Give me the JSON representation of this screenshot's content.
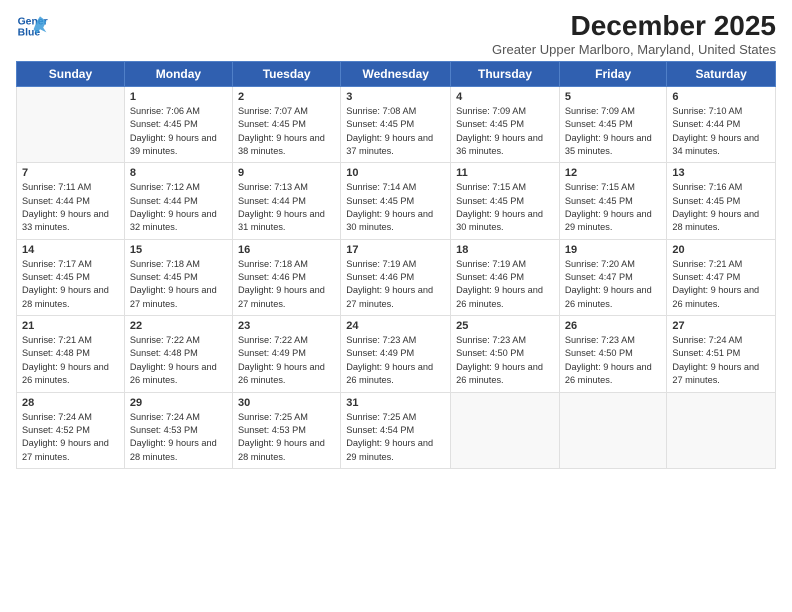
{
  "logo": {
    "line1": "General",
    "line2": "Blue"
  },
  "title": "December 2025",
  "subtitle": "Greater Upper Marlboro, Maryland, United States",
  "weekdays": [
    "Sunday",
    "Monday",
    "Tuesday",
    "Wednesday",
    "Thursday",
    "Friday",
    "Saturday"
  ],
  "weeks": [
    [
      {
        "day": "",
        "sunrise": "",
        "sunset": "",
        "daylight": ""
      },
      {
        "day": "1",
        "sunrise": "Sunrise: 7:06 AM",
        "sunset": "Sunset: 4:45 PM",
        "daylight": "Daylight: 9 hours and 39 minutes."
      },
      {
        "day": "2",
        "sunrise": "Sunrise: 7:07 AM",
        "sunset": "Sunset: 4:45 PM",
        "daylight": "Daylight: 9 hours and 38 minutes."
      },
      {
        "day": "3",
        "sunrise": "Sunrise: 7:08 AM",
        "sunset": "Sunset: 4:45 PM",
        "daylight": "Daylight: 9 hours and 37 minutes."
      },
      {
        "day": "4",
        "sunrise": "Sunrise: 7:09 AM",
        "sunset": "Sunset: 4:45 PM",
        "daylight": "Daylight: 9 hours and 36 minutes."
      },
      {
        "day": "5",
        "sunrise": "Sunrise: 7:09 AM",
        "sunset": "Sunset: 4:45 PM",
        "daylight": "Daylight: 9 hours and 35 minutes."
      },
      {
        "day": "6",
        "sunrise": "Sunrise: 7:10 AM",
        "sunset": "Sunset: 4:44 PM",
        "daylight": "Daylight: 9 hours and 34 minutes."
      }
    ],
    [
      {
        "day": "7",
        "sunrise": "Sunrise: 7:11 AM",
        "sunset": "Sunset: 4:44 PM",
        "daylight": "Daylight: 9 hours and 33 minutes."
      },
      {
        "day": "8",
        "sunrise": "Sunrise: 7:12 AM",
        "sunset": "Sunset: 4:44 PM",
        "daylight": "Daylight: 9 hours and 32 minutes."
      },
      {
        "day": "9",
        "sunrise": "Sunrise: 7:13 AM",
        "sunset": "Sunset: 4:44 PM",
        "daylight": "Daylight: 9 hours and 31 minutes."
      },
      {
        "day": "10",
        "sunrise": "Sunrise: 7:14 AM",
        "sunset": "Sunset: 4:45 PM",
        "daylight": "Daylight: 9 hours and 30 minutes."
      },
      {
        "day": "11",
        "sunrise": "Sunrise: 7:15 AM",
        "sunset": "Sunset: 4:45 PM",
        "daylight": "Daylight: 9 hours and 30 minutes."
      },
      {
        "day": "12",
        "sunrise": "Sunrise: 7:15 AM",
        "sunset": "Sunset: 4:45 PM",
        "daylight": "Daylight: 9 hours and 29 minutes."
      },
      {
        "day": "13",
        "sunrise": "Sunrise: 7:16 AM",
        "sunset": "Sunset: 4:45 PM",
        "daylight": "Daylight: 9 hours and 28 minutes."
      }
    ],
    [
      {
        "day": "14",
        "sunrise": "Sunrise: 7:17 AM",
        "sunset": "Sunset: 4:45 PM",
        "daylight": "Daylight: 9 hours and 28 minutes."
      },
      {
        "day": "15",
        "sunrise": "Sunrise: 7:18 AM",
        "sunset": "Sunset: 4:45 PM",
        "daylight": "Daylight: 9 hours and 27 minutes."
      },
      {
        "day": "16",
        "sunrise": "Sunrise: 7:18 AM",
        "sunset": "Sunset: 4:46 PM",
        "daylight": "Daylight: 9 hours and 27 minutes."
      },
      {
        "day": "17",
        "sunrise": "Sunrise: 7:19 AM",
        "sunset": "Sunset: 4:46 PM",
        "daylight": "Daylight: 9 hours and 27 minutes."
      },
      {
        "day": "18",
        "sunrise": "Sunrise: 7:19 AM",
        "sunset": "Sunset: 4:46 PM",
        "daylight": "Daylight: 9 hours and 26 minutes."
      },
      {
        "day": "19",
        "sunrise": "Sunrise: 7:20 AM",
        "sunset": "Sunset: 4:47 PM",
        "daylight": "Daylight: 9 hours and 26 minutes."
      },
      {
        "day": "20",
        "sunrise": "Sunrise: 7:21 AM",
        "sunset": "Sunset: 4:47 PM",
        "daylight": "Daylight: 9 hours and 26 minutes."
      }
    ],
    [
      {
        "day": "21",
        "sunrise": "Sunrise: 7:21 AM",
        "sunset": "Sunset: 4:48 PM",
        "daylight": "Daylight: 9 hours and 26 minutes."
      },
      {
        "day": "22",
        "sunrise": "Sunrise: 7:22 AM",
        "sunset": "Sunset: 4:48 PM",
        "daylight": "Daylight: 9 hours and 26 minutes."
      },
      {
        "day": "23",
        "sunrise": "Sunrise: 7:22 AM",
        "sunset": "Sunset: 4:49 PM",
        "daylight": "Daylight: 9 hours and 26 minutes."
      },
      {
        "day": "24",
        "sunrise": "Sunrise: 7:23 AM",
        "sunset": "Sunset: 4:49 PM",
        "daylight": "Daylight: 9 hours and 26 minutes."
      },
      {
        "day": "25",
        "sunrise": "Sunrise: 7:23 AM",
        "sunset": "Sunset: 4:50 PM",
        "daylight": "Daylight: 9 hours and 26 minutes."
      },
      {
        "day": "26",
        "sunrise": "Sunrise: 7:23 AM",
        "sunset": "Sunset: 4:50 PM",
        "daylight": "Daylight: 9 hours and 26 minutes."
      },
      {
        "day": "27",
        "sunrise": "Sunrise: 7:24 AM",
        "sunset": "Sunset: 4:51 PM",
        "daylight": "Daylight: 9 hours and 27 minutes."
      }
    ],
    [
      {
        "day": "28",
        "sunrise": "Sunrise: 7:24 AM",
        "sunset": "Sunset: 4:52 PM",
        "daylight": "Daylight: 9 hours and 27 minutes."
      },
      {
        "day": "29",
        "sunrise": "Sunrise: 7:24 AM",
        "sunset": "Sunset: 4:53 PM",
        "daylight": "Daylight: 9 hours and 28 minutes."
      },
      {
        "day": "30",
        "sunrise": "Sunrise: 7:25 AM",
        "sunset": "Sunset: 4:53 PM",
        "daylight": "Daylight: 9 hours and 28 minutes."
      },
      {
        "day": "31",
        "sunrise": "Sunrise: 7:25 AM",
        "sunset": "Sunset: 4:54 PM",
        "daylight": "Daylight: 9 hours and 29 minutes."
      },
      {
        "day": "",
        "sunrise": "",
        "sunset": "",
        "daylight": ""
      },
      {
        "day": "",
        "sunrise": "",
        "sunset": "",
        "daylight": ""
      },
      {
        "day": "",
        "sunrise": "",
        "sunset": "",
        "daylight": ""
      }
    ]
  ]
}
